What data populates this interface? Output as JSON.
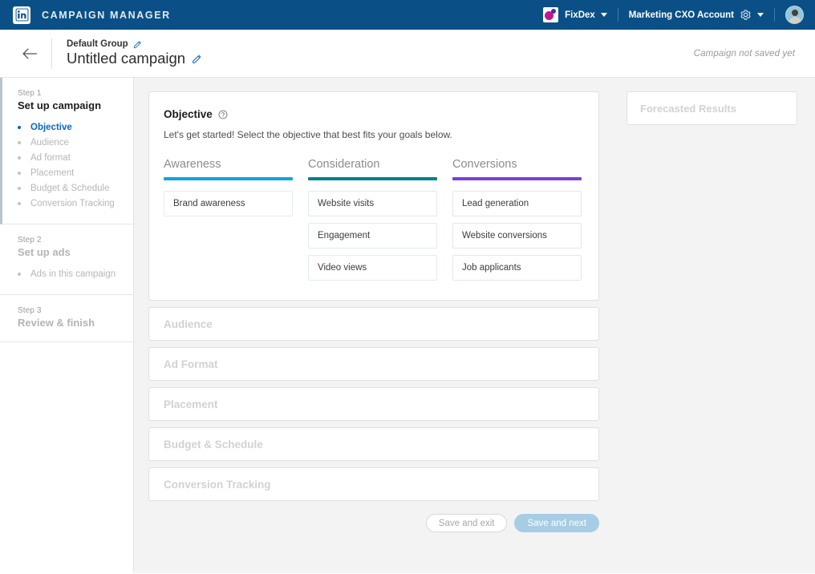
{
  "header": {
    "logo_icon": "linkedin-logo",
    "product_name": "CAMPAIGN MANAGER",
    "brand": {
      "icon": "fixdex-logo",
      "label": "FixDex",
      "caret_icon": "chevron-down-icon"
    },
    "account": {
      "label": "Marketing CXO Account",
      "gear_icon": "gear-icon",
      "caret_icon": "chevron-down-icon"
    },
    "avatar_icon": "user-avatar"
  },
  "titlebar": {
    "back_icon": "back-arrow-icon",
    "group_name": "Default Group",
    "group_edit_icon": "pencil-icon",
    "campaign_name": "Untitled campaign",
    "campaign_edit_icon": "pencil-icon",
    "save_status": "Campaign not saved yet"
  },
  "sidebar": {
    "steps": [
      {
        "number": "Step 1",
        "title": "Set up campaign",
        "active": true,
        "items": [
          {
            "label": "Objective",
            "selected": true
          },
          {
            "label": "Audience",
            "selected": false
          },
          {
            "label": "Ad format",
            "selected": false
          },
          {
            "label": "Placement",
            "selected": false
          },
          {
            "label": "Budget & Schedule",
            "selected": false
          },
          {
            "label": "Conversion Tracking",
            "selected": false
          }
        ]
      },
      {
        "number": "Step 2",
        "title": "Set up ads",
        "active": false,
        "items": [
          {
            "label": "Ads in this campaign",
            "selected": false
          }
        ]
      },
      {
        "number": "Step 3",
        "title": "Review & finish",
        "active": false,
        "items": []
      }
    ]
  },
  "objective_card": {
    "title": "Objective",
    "help_icon": "help-circle-icon",
    "subtitle": "Let's get started! Select the objective that best fits your goals below.",
    "columns": [
      {
        "title": "Awareness",
        "color": "#0ca6dc",
        "border_color": "#e2eef3",
        "options": [
          "Brand awareness"
        ]
      },
      {
        "title": "Consideration",
        "color": "#00808c",
        "border_color": "#dfeced",
        "options": [
          "Website visits",
          "Engagement",
          "Video views"
        ]
      },
      {
        "title": "Conversions",
        "color": "#7a3ee0",
        "border_color": "#e6e3f2",
        "options": [
          "Lead generation",
          "Website conversions",
          "Job applicants"
        ]
      }
    ]
  },
  "collapsed_sections": [
    {
      "title": "Audience"
    },
    {
      "title": "Ad Format"
    },
    {
      "title": "Placement"
    },
    {
      "title": "Budget & Schedule"
    },
    {
      "title": "Conversion Tracking"
    }
  ],
  "actions": {
    "save_exit_label": "Save and exit",
    "save_next_label": "Save and next"
  },
  "right_panel": {
    "forecast_title": "Forecasted Results"
  },
  "colors": {
    "header_blue": "#0a5087",
    "accent_blue": "#0a66c2",
    "page_bg": "#f3f3f3",
    "awareness": "#0ca6dc",
    "consideration": "#00808c",
    "conversions": "#7a3ee0",
    "primary_button": "#a7cde4"
  }
}
